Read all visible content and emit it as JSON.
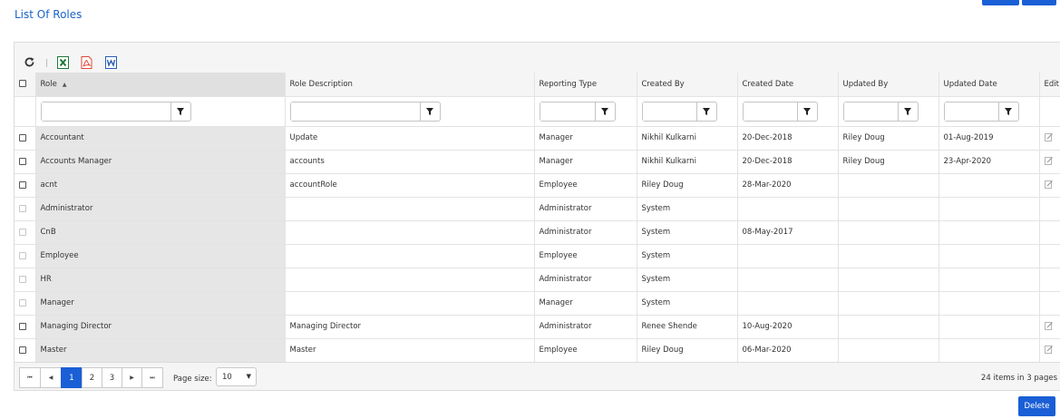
{
  "page": {
    "title": "List Of Roles"
  },
  "toolbar": {
    "refresh_icon": "refresh-icon",
    "excel_icon": "excel-icon",
    "pdf_icon": "pdf-icon",
    "word_icon": "word-icon"
  },
  "columns": [
    "Role",
    "Role Description",
    "Reporting Type",
    "Created By",
    "Created Date",
    "Updated By",
    "Updated Date",
    "Edit"
  ],
  "rows": [
    {
      "role": "Accountant",
      "description": "Update",
      "reporting_type": "Manager",
      "created_by": "Nikhil Kulkarni",
      "created_date": "20-Dec-2018",
      "updated_by": "Riley Doug",
      "updated_date": "01-Aug-2019",
      "editable": true
    },
    {
      "role": "Accounts Manager",
      "description": "accounts",
      "reporting_type": "Manager",
      "created_by": "Nikhil Kulkarni",
      "created_date": "20-Dec-2018",
      "updated_by": "Riley Doug",
      "updated_date": "23-Apr-2020",
      "editable": true
    },
    {
      "role": "acnt",
      "description": "accountRole",
      "reporting_type": "Employee",
      "created_by": "Riley Doug",
      "created_date": "28-Mar-2020",
      "updated_by": "",
      "updated_date": "",
      "editable": true
    },
    {
      "role": "Administrator",
      "description": "",
      "reporting_type": "Administrator",
      "created_by": "System",
      "created_date": "",
      "updated_by": "",
      "updated_date": "",
      "editable": false
    },
    {
      "role": "CnB",
      "description": "",
      "reporting_type": "Administrator",
      "created_by": "System",
      "created_date": "08-May-2017",
      "updated_by": "",
      "updated_date": "",
      "editable": false
    },
    {
      "role": "Employee",
      "description": "",
      "reporting_type": "Employee",
      "created_by": "System",
      "created_date": "",
      "updated_by": "",
      "updated_date": "",
      "editable": false
    },
    {
      "role": "HR",
      "description": "",
      "reporting_type": "Administrator",
      "created_by": "System",
      "created_date": "",
      "updated_by": "",
      "updated_date": "",
      "editable": false
    },
    {
      "role": "Manager",
      "description": "",
      "reporting_type": "Manager",
      "created_by": "System",
      "created_date": "",
      "updated_by": "",
      "updated_date": "",
      "editable": false
    },
    {
      "role": "Managing Director",
      "description": "Managing Director",
      "reporting_type": "Administrator",
      "created_by": "Renee Shende",
      "created_date": "10-Aug-2020",
      "updated_by": "",
      "updated_date": "",
      "editable": true
    },
    {
      "role": "Master",
      "description": "Master",
      "reporting_type": "Employee",
      "created_by": "Riley Doug",
      "created_date": "06-Mar-2020",
      "updated_by": "",
      "updated_date": "",
      "editable": true
    }
  ],
  "pager": {
    "pages": [
      "1",
      "2",
      "3"
    ],
    "current_page": "1",
    "page_size_label": "Page size:",
    "page_size": "10",
    "info": "24 items in 3 pages"
  },
  "actions": {
    "delete_label": "Delete"
  },
  "colors": {
    "accent": "#1a5fd6",
    "title": "#1a62c9"
  }
}
